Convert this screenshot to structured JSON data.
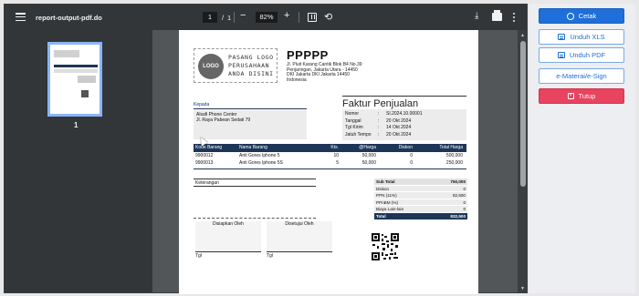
{
  "toolbar": {
    "title": "report-output-pdf.do",
    "current_page": "1",
    "page_separator": "/",
    "total_pages": "1",
    "zoom": "82%",
    "minus": "−",
    "plus": "+",
    "rotate_glyph": "⟲",
    "download_glyph": "⤓"
  },
  "sidebar": {
    "thumbnail_page_number": "1"
  },
  "document": {
    "logo_circle_text": "LOGO",
    "logo_text_lines": [
      "PASANG LOGO",
      "PERUSAHAAN",
      "ANDA DISINI"
    ],
    "company_name": "PPPPP",
    "company_address_lines": [
      "Jl. Pluit Karang Cantik Blok B4 No.39",
      "Penjaringan, Jakarta Utara - 14450",
      "DKI Jakarta DKI Jakarta 14450",
      "Indonesia"
    ],
    "to_label": "Kepada",
    "to_lines": [
      "Alsafi Phone Center",
      "Jl. Raya Pabean Sedati 79"
    ],
    "invoice_title": "Faktur Penjualan",
    "invoice_meta": [
      {
        "key": "Nomor",
        "sep": ":",
        "value": "SI.2024.10.00001"
      },
      {
        "key": "Tanggal",
        "sep": ":",
        "value": "20 Okt 2024"
      },
      {
        "key": "Tgl Kirim",
        "sep": ":",
        "value": "14 Okt 2024"
      },
      {
        "key": "Jatuh Tempo",
        "sep": ":",
        "value": "20 Okt 2024"
      }
    ],
    "items_header": {
      "code": "Kode Barang",
      "name": "Nama Barang",
      "qty": "Kts.",
      "price": "@Harga",
      "discount": "Diskon",
      "total": "Total Harga"
    },
    "items": [
      {
        "code": "9900012",
        "name": "Anti Gores Iphone 5",
        "qty": "10",
        "price": "50,000",
        "discount": "0",
        "total": "500,000"
      },
      {
        "code": "9900013",
        "name": "Anti Gores Iphone 5S",
        "qty": "5",
        "price": "50,000",
        "discount": "0",
        "total": "250,000"
      }
    ],
    "notes_label": "Keterangan",
    "summary": [
      {
        "label": "Sub Total",
        "value": "750,000"
      },
      {
        "label": "Diskon",
        "value": "0"
      },
      {
        "label": "PPN (11%)",
        "value": "82,500"
      },
      {
        "label": "PPnBM (%)",
        "value": "0"
      },
      {
        "label": "Biaya Lain-lain",
        "value": "0"
      },
      {
        "label": "Total",
        "value": "832,500"
      }
    ],
    "prepared_by": "Disiapkan Oleh",
    "approved_by": "Disetujui Oleh",
    "date_label_1": "Tgl",
    "date_label_2": "Tgl"
  },
  "actions": {
    "print": "Cetak",
    "export_xls": "Unduh XLS",
    "export_pdf": "Unduh PDF",
    "e_materai": "e-Materai/e-Sign",
    "close": "Tutup",
    "close_icon_glyph": "×"
  },
  "colors": {
    "accent": "#1e6fd9",
    "danger": "#e8435f",
    "table_header": "#1d3557",
    "viewer_bg": "#525659",
    "toolbar_bg": "#323639"
  }
}
